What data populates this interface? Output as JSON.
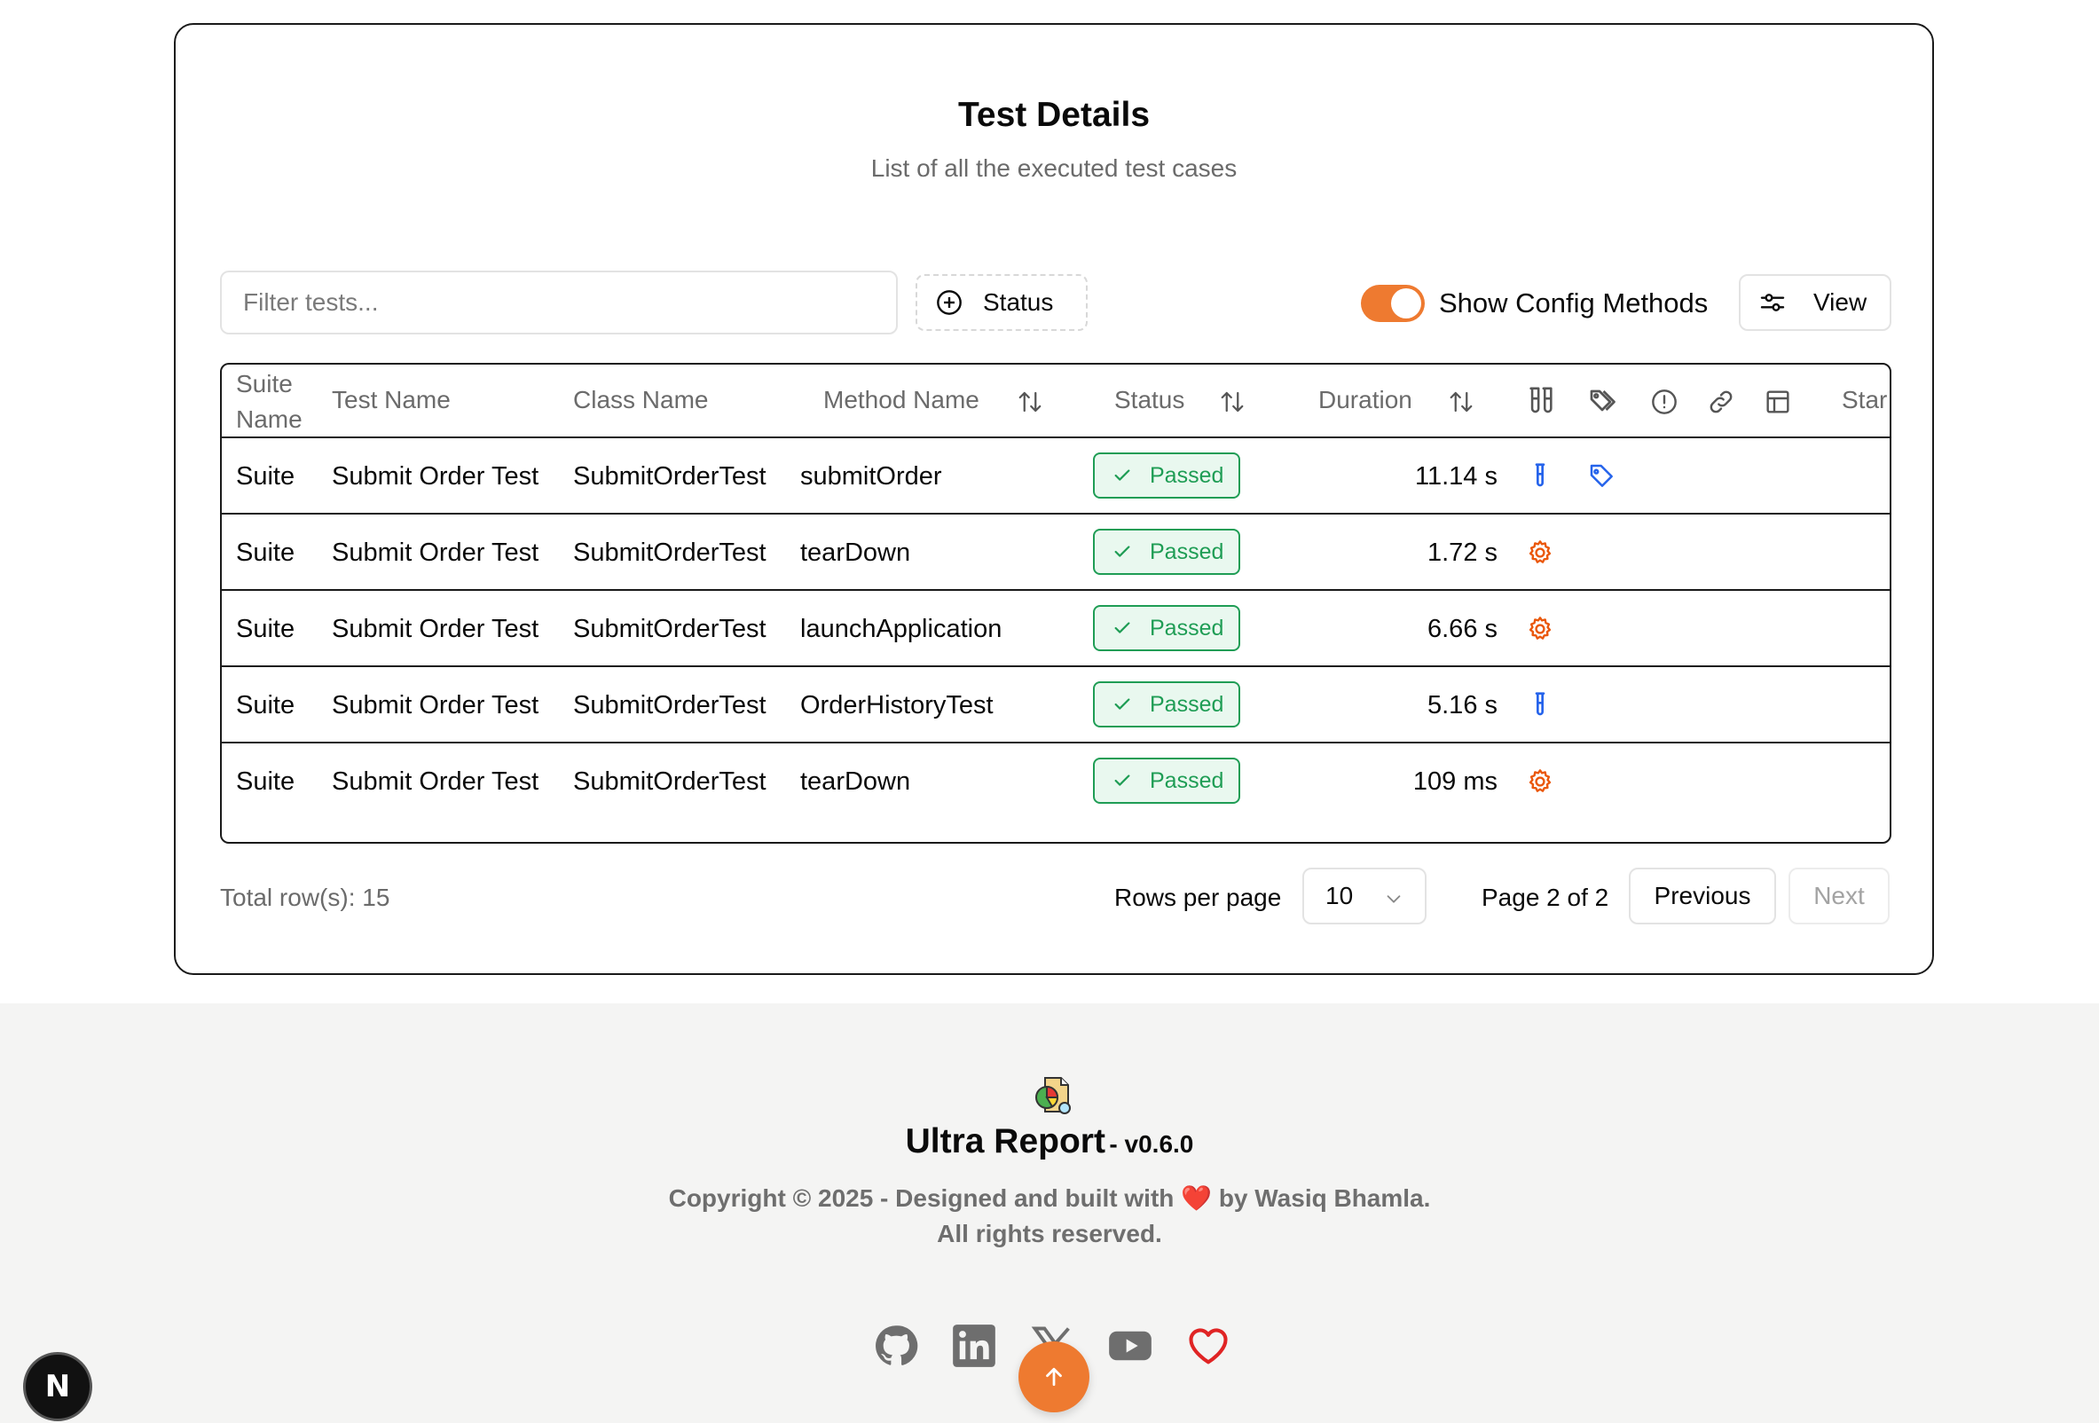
{
  "card": {
    "title": "Test Details",
    "subtitle": "List of all the executed test cases"
  },
  "toolbar": {
    "filter_placeholder": "Filter tests...",
    "status_label": "Status",
    "toggle_label": "Show Config Methods",
    "toggle_on": true,
    "view_label": "View"
  },
  "table": {
    "headers": {
      "suite_line1": "Suite",
      "suite_line2": "Name",
      "test_name": "Test Name",
      "class_name": "Class Name",
      "method_name": "Method Name",
      "status": "Status",
      "duration": "Duration",
      "start": "Star"
    },
    "header_icons": [
      "test-tube-icon",
      "tags-icon",
      "alert-circle-icon",
      "link-icon",
      "table-icon"
    ],
    "rows": [
      {
        "suite": "Suite",
        "test": "Submit Order Test",
        "class": "SubmitOrderTest",
        "method": "submitOrder",
        "status": "Passed",
        "duration": "11.14 s",
        "type": "test",
        "tagged": true
      },
      {
        "suite": "Suite",
        "test": "Submit Order Test",
        "class": "SubmitOrderTest",
        "method": "tearDown",
        "status": "Passed",
        "duration": "1.72 s",
        "type": "config",
        "tagged": false
      },
      {
        "suite": "Suite",
        "test": "Submit Order Test",
        "class": "SubmitOrderTest",
        "method": "launchApplication",
        "status": "Passed",
        "duration": "6.66 s",
        "type": "config",
        "tagged": false
      },
      {
        "suite": "Suite",
        "test": "Submit Order Test",
        "class": "SubmitOrderTest",
        "method": "OrderHistoryTest",
        "status": "Passed",
        "duration": "5.16 s",
        "type": "test",
        "tagged": false
      },
      {
        "suite": "Suite",
        "test": "Submit Order Test",
        "class": "SubmitOrderTest",
        "method": "tearDown",
        "status": "Passed",
        "duration": "109 ms",
        "type": "config",
        "tagged": false
      }
    ]
  },
  "pagination": {
    "total_rows": "Total row(s): 15",
    "rows_per_page_label": "Rows per page",
    "rows_per_page_value": "10",
    "page_label": "Page 2 of 2",
    "previous": "Previous",
    "next": "Next"
  },
  "footer": {
    "brand": "Ultra Report",
    "version": "- v0.6.0",
    "copyright_line1_before": "Copyright © 2025 - Designed and built with",
    "heart": "❤️",
    "copyright_line1_after": "by Wasiq Bhamla.",
    "copyright_line2": "All rights reserved.",
    "socials": [
      "github-icon",
      "linkedin-icon",
      "x-icon",
      "youtube-icon",
      "heart-icon"
    ]
  },
  "floating": {
    "next_badge": "N"
  },
  "colors": {
    "accent": "#ee7a30",
    "passed": "#1f9d55",
    "test_icon": "#2563eb",
    "config_icon": "#ea580c"
  }
}
